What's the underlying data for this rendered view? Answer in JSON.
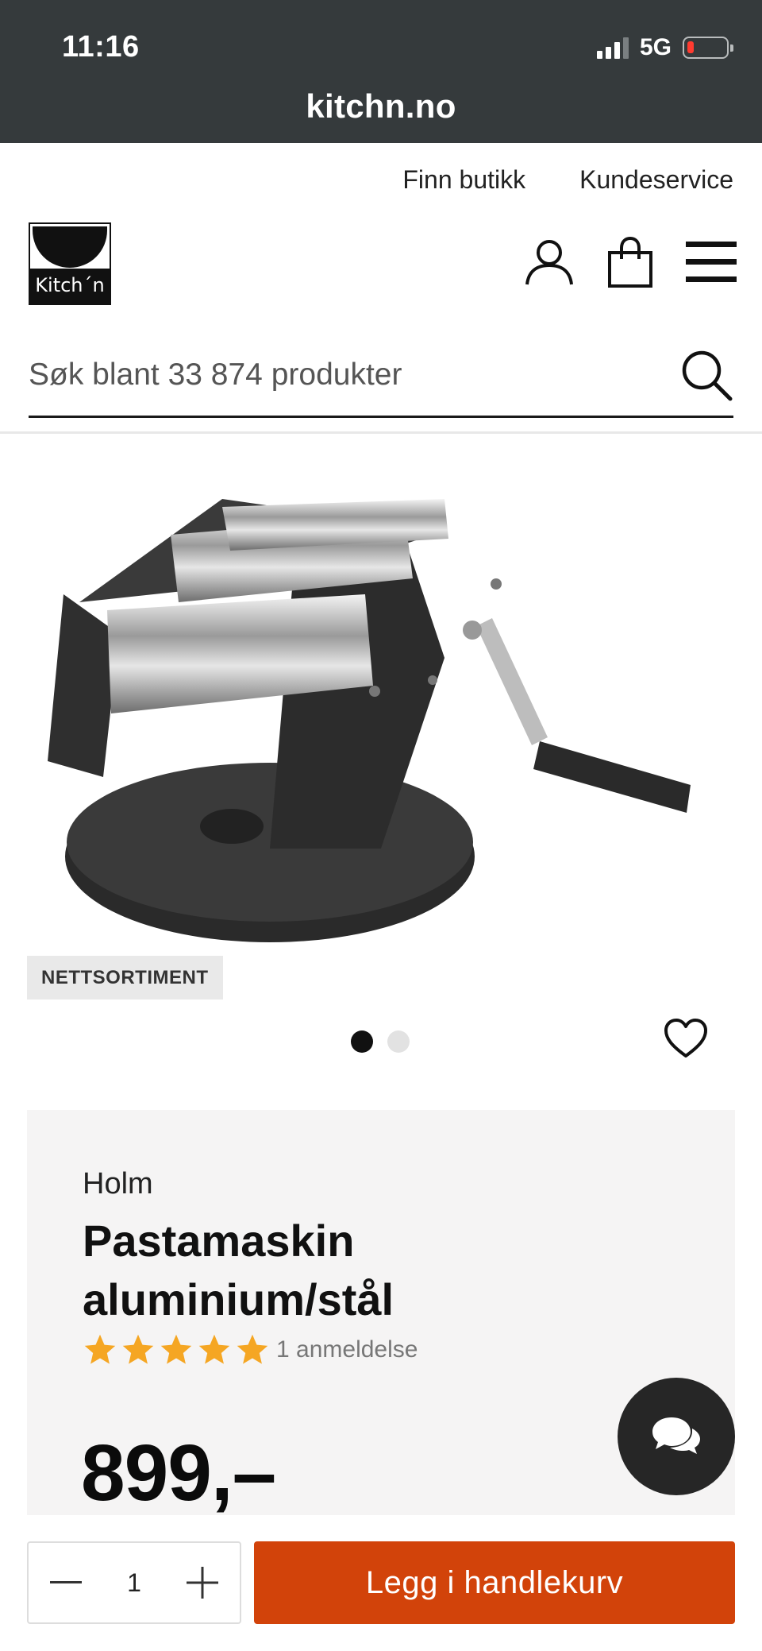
{
  "status_bar": {
    "time": "11:16",
    "network": "5G"
  },
  "browser": {
    "url": "kitchn.no"
  },
  "header": {
    "links": [
      "Finn butikk",
      "Kundeservice"
    ],
    "logo_text": "Kitch´n"
  },
  "search": {
    "placeholder": "Søk blant 33 874 produkter"
  },
  "product": {
    "badge": "NETTSORTIMENT",
    "image_count": 2,
    "active_image": 1,
    "brand": "Holm",
    "name": "Pastamaskin aluminium/stål",
    "rating": 5,
    "rating_max": 5,
    "reviews": "1 anmeldelse",
    "price": "899,–"
  },
  "cart": {
    "quantity": "1",
    "add_label": "Legg i handlekurv"
  },
  "colors": {
    "accent": "#d2430a",
    "star": "#f5a623",
    "chrome": "#353a3c"
  },
  "icons": [
    "user-icon",
    "shopping-bag-icon",
    "menu-icon",
    "search-icon",
    "heart-icon",
    "chat-icon",
    "minus-icon",
    "plus-icon"
  ]
}
